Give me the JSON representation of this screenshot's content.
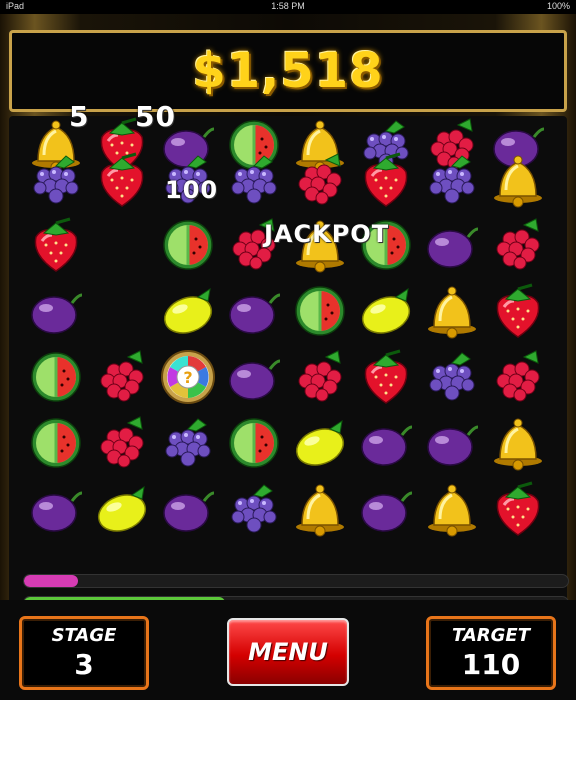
{
  "status_bar": {
    "carrier": "iPad",
    "time": "1:58 PM",
    "battery": "100%"
  },
  "score": {
    "value": "$1,518",
    "color": "#ffd21a"
  },
  "board": {
    "rows": [
      [
        "bell",
        "strawberry",
        "plum",
        "watermelon",
        "bell",
        "grapes",
        "raspberry",
        "plum"
      ],
      [
        "grapes",
        "strawberry",
        "grapes",
        "grapes",
        "raspberry",
        "strawberry",
        "grapes",
        "bell"
      ],
      [
        "strawberry",
        "",
        "watermelon",
        "raspberry",
        "bell",
        "watermelon",
        "plum",
        "raspberry"
      ],
      [
        "plum",
        "",
        "lemon",
        "plum",
        "watermelon",
        "lemon",
        "bell",
        "strawberry"
      ],
      [
        "watermelon",
        "raspberry",
        "bonus-wheel",
        "plum",
        "raspberry",
        "strawberry",
        "grapes",
        "raspberry"
      ],
      [
        "watermelon",
        "raspberry",
        "grapes",
        "watermelon",
        "lemon",
        "plum",
        "plum",
        "bell"
      ],
      [
        "plum",
        "lemon",
        "plum",
        "grapes",
        "bell",
        "plum",
        "bell",
        "strawberry"
      ]
    ],
    "floating_texts": [
      {
        "text": "5",
        "id": "points-5"
      },
      {
        "text": "50",
        "id": "points-50"
      },
      {
        "text": "100",
        "id": "points-100"
      },
      {
        "text": "JACKPOT",
        "id": "jackpot"
      }
    ]
  },
  "progress": {
    "top": {
      "fraction": 0.1,
      "color": "#d63cb4"
    },
    "bottom": {
      "fraction": 0.37,
      "color": "#5cc83a"
    }
  },
  "hud": {
    "stage_label": "STAGE",
    "stage_value": "3",
    "menu_label": "MENU",
    "target_label": "TARGET",
    "target_value": "110"
  }
}
